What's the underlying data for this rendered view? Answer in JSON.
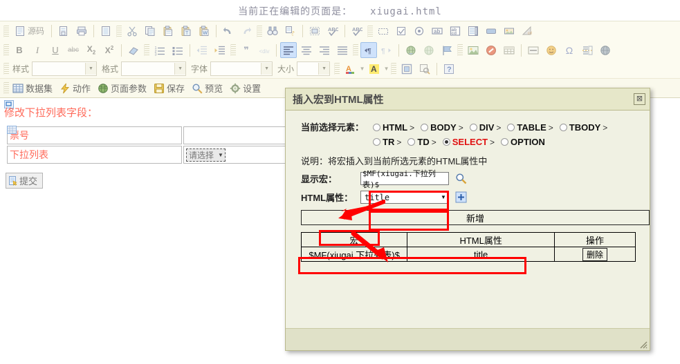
{
  "page_note": {
    "label": "当前正在编辑的页面是：",
    "file": "xiugai.html"
  },
  "toolbar": {
    "row1": [
      {
        "name": "source-button",
        "icon": "document",
        "label": "源码"
      },
      {
        "name": "new-page-button",
        "icon": "newpage",
        "label": ""
      },
      {
        "name": "print-button",
        "icon": "print",
        "label": ""
      },
      {
        "name": "templates-button",
        "icon": "templates",
        "label": ""
      },
      {
        "name": "cut-button",
        "icon": "scissors",
        "label": ""
      },
      {
        "name": "copy-button",
        "icon": "copy",
        "label": ""
      },
      {
        "name": "paste-button",
        "icon": "paste",
        "label": ""
      },
      {
        "name": "paste-text-button",
        "icon": "paste-text",
        "label": ""
      },
      {
        "name": "paste-word-button",
        "icon": "paste-word",
        "label": ""
      },
      {
        "name": "undo-button",
        "icon": "undo",
        "label": ""
      },
      {
        "name": "redo-button",
        "icon": "redo",
        "label": ""
      },
      {
        "name": "find-button",
        "icon": "binoculars",
        "label": ""
      },
      {
        "name": "replace-button",
        "icon": "replace",
        "label": ""
      },
      {
        "name": "select-all-button",
        "icon": "selectall",
        "label": ""
      },
      {
        "name": "spellcheck-button",
        "icon": "abc-check",
        "label": ""
      },
      {
        "name": "spellcheck-scayt-button",
        "icon": "abc-check2",
        "label": ""
      },
      {
        "name": "form-button",
        "icon": "form",
        "label": ""
      },
      {
        "name": "checkbox-button",
        "icon": "checkbox",
        "label": ""
      },
      {
        "name": "radio-button",
        "icon": "radio",
        "label": ""
      },
      {
        "name": "textfield-button",
        "icon": "textfield",
        "label": ""
      },
      {
        "name": "textarea-button",
        "icon": "textarea",
        "label": ""
      },
      {
        "name": "selectfield-button",
        "icon": "selectfield",
        "label": ""
      },
      {
        "name": "button-button",
        "icon": "button",
        "label": ""
      },
      {
        "name": "imagebutton-button",
        "icon": "imagebutton",
        "label": ""
      },
      {
        "name": "hiddenfield-button",
        "icon": "hiddenfield",
        "label": ""
      }
    ],
    "row2": [
      {
        "name": "bold-button",
        "icon": "bold",
        "label": "B"
      },
      {
        "name": "italic-button",
        "icon": "italic",
        "label": "I"
      },
      {
        "name": "underline-button",
        "icon": "underline",
        "label": "U"
      },
      {
        "name": "strike-button",
        "icon": "strike",
        "label": "abc"
      },
      {
        "name": "subscript-button",
        "icon": "subscript",
        "label": "X₂"
      },
      {
        "name": "superscript-button",
        "icon": "superscript",
        "label": "X²"
      },
      {
        "name": "removeformat-button",
        "icon": "eraser",
        "label": ""
      },
      {
        "name": "numbered-list-button",
        "icon": "ol",
        "label": ""
      },
      {
        "name": "bulleted-list-button",
        "icon": "ul",
        "label": ""
      },
      {
        "name": "outdent-button",
        "icon": "outdent",
        "label": ""
      },
      {
        "name": "indent-button",
        "icon": "indent",
        "label": ""
      },
      {
        "name": "blockquote-button",
        "icon": "quote",
        "label": ""
      },
      {
        "name": "creatediv-button",
        "icon": "div",
        "label": ""
      },
      {
        "name": "align-left-button",
        "icon": "align-left",
        "label": ""
      },
      {
        "name": "align-center-button",
        "icon": "align-center",
        "label": ""
      },
      {
        "name": "align-right-button",
        "icon": "align-right",
        "label": ""
      },
      {
        "name": "align-justify-button",
        "icon": "align-justify",
        "label": ""
      },
      {
        "name": "ltr-button",
        "icon": "ltr",
        "label": ""
      },
      {
        "name": "rtl-button",
        "icon": "rtl",
        "label": ""
      },
      {
        "name": "link-button",
        "icon": "globe-link",
        "label": ""
      },
      {
        "name": "unlink-button",
        "icon": "globe-unlink",
        "label": ""
      },
      {
        "name": "anchor-button",
        "icon": "flag",
        "label": ""
      },
      {
        "name": "image-button",
        "icon": "image",
        "label": ""
      },
      {
        "name": "flash-button",
        "icon": "flash",
        "label": ""
      },
      {
        "name": "table-button",
        "icon": "table",
        "label": ""
      },
      {
        "name": "hr-button",
        "icon": "hr",
        "label": ""
      },
      {
        "name": "smiley-button",
        "icon": "smiley",
        "label": ""
      },
      {
        "name": "specialchar-button",
        "icon": "omega",
        "label": ""
      },
      {
        "name": "pagebreak-button",
        "icon": "pagebreak",
        "label": ""
      },
      {
        "name": "iframe-button",
        "icon": "iframe",
        "label": ""
      }
    ],
    "row3": {
      "style": {
        "label": "样式",
        "value": ""
      },
      "format": {
        "label": "格式",
        "value": ""
      },
      "font": {
        "label": "字体",
        "value": ""
      },
      "size": {
        "label": "大小",
        "value": ""
      },
      "buttons": [
        {
          "name": "text-color-button",
          "icon": "text-color",
          "label": "A"
        },
        {
          "name": "bg-color-button",
          "icon": "bg-color",
          "label": "A"
        },
        {
          "name": "maximize-button",
          "icon": "maximize",
          "label": ""
        },
        {
          "name": "show-blocks-button",
          "icon": "show-blocks",
          "label": ""
        },
        {
          "name": "about-button",
          "icon": "question",
          "label": "?"
        }
      ]
    },
    "row4": [
      {
        "name": "dataset-menu",
        "icon": "grid",
        "label": "数据集"
      },
      {
        "name": "action-menu",
        "icon": "bolt",
        "label": "动作"
      },
      {
        "name": "page-params-menu",
        "icon": "globe",
        "label": "页面参数"
      },
      {
        "name": "save-menu",
        "icon": "floppy",
        "label": "保存"
      },
      {
        "name": "preview-menu",
        "icon": "magnifier",
        "label": "预览"
      },
      {
        "name": "settings-menu",
        "icon": "gear",
        "label": "设置"
      }
    ]
  },
  "document": {
    "title": "修改下拉列表字段：",
    "rows": [
      {
        "label": "票号",
        "value": "",
        "type": "text"
      },
      {
        "label": "下拉列表",
        "value": "请选择",
        "type": "select"
      }
    ],
    "submit_label": "提交"
  },
  "dialog": {
    "title": "插入宏到HTML属性",
    "close_label": "⊠",
    "elements_label": "当前选择元素：",
    "elements": [
      {
        "name": "HTML",
        "selected": false,
        "sep": ">"
      },
      {
        "name": "BODY",
        "selected": false,
        "sep": ">"
      },
      {
        "name": "DIV",
        "selected": false,
        "sep": ">"
      },
      {
        "name": "TABLE",
        "selected": false,
        "sep": ">"
      },
      {
        "name": "TBODY",
        "selected": false,
        "sep": ">"
      },
      {
        "name": "TR",
        "selected": false,
        "sep": ">"
      },
      {
        "name": "TD",
        "selected": false,
        "sep": ">"
      },
      {
        "name": "SELECT",
        "selected": true,
        "sep": ">"
      },
      {
        "name": "OPTION",
        "selected": false,
        "sep": ""
      }
    ],
    "description": "说明：将宏插入到当前所选元素的HTML属性中",
    "macro_label": "显示宏：",
    "macro_value": "$MF(xiugai.下拉列表)$",
    "attr_label": "HTML属性：",
    "attr_value": "title",
    "add_label": "新增",
    "table": {
      "headers": [
        "宏",
        "HTML属性",
        "操作"
      ],
      "rows": [
        {
          "macro": "$MF(xiugai.下拉列表)$",
          "attr": "title",
          "op": "删除"
        }
      ]
    }
  },
  "colors": {
    "accent_red": "#ff0000",
    "doc_text": "#ff6a5a",
    "selected_element": "#e01010",
    "dialog_bg": "#f0f1e3",
    "dialog_title_bg": "#e6e7c9"
  }
}
